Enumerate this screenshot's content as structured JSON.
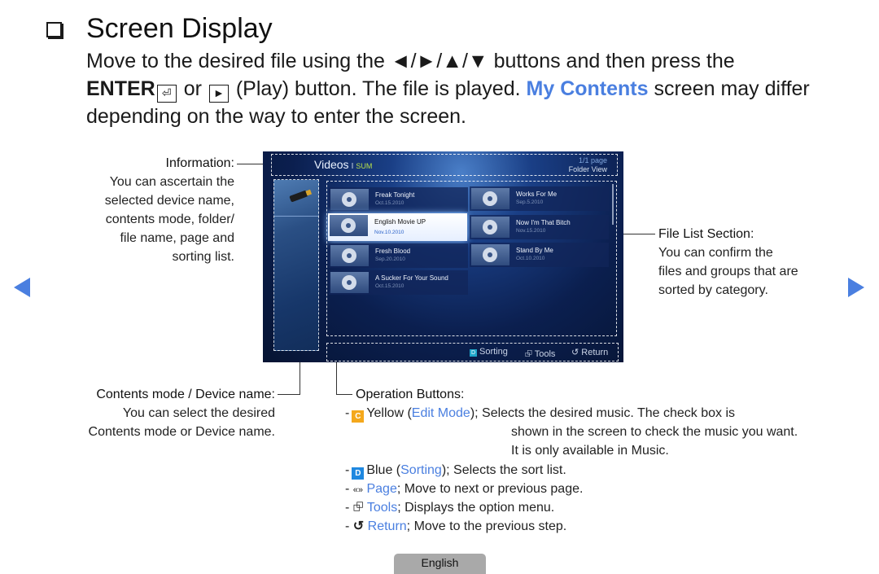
{
  "heading": {
    "checkbox_icon": "square-checkbox-icon",
    "title": "Screen Display"
  },
  "intro": {
    "line1_prefix": "Move to the desired file using the",
    "arrows": "◄/►/▲/▼",
    "line1_suffix": "buttons and then press the",
    "enter_label": "ENTER",
    "enter_icon": "⏎",
    "or": "or",
    "play_icon": "►",
    "line2_mid": "(Play) button. The file is played.",
    "my_contents": "My Contents",
    "line2_suffix": "screen may differ",
    "line3": "depending on the way to enter the screen."
  },
  "nav": {
    "prev_icon": "triangle-left-icon",
    "next_icon": "triangle-right-icon"
  },
  "callouts": {
    "information": {
      "title": "Information",
      "colon": ":",
      "lines": [
        "You can ascertain the",
        "selected device name,",
        "contents mode, folder/",
        "file name, page and",
        "sorting list."
      ]
    },
    "file_list": {
      "title": "File List Section",
      "colon": ":",
      "lines": [
        "You can confirm the",
        "files and groups that are",
        "sorted by category."
      ]
    },
    "contents_mode": {
      "title": "Contents mode / Device name",
      "colon": ":",
      "lines": [
        "You can select the desired",
        "Contents mode or Device name."
      ]
    },
    "operation_buttons": {
      "title": "Operation Buttons",
      "colon": ":"
    }
  },
  "tv": {
    "title": "Videos",
    "separator": "I",
    "mode": "SUM",
    "page": "1/1 page",
    "view": "Folder View",
    "files": [
      {
        "name": "Freak Tonight",
        "date": "Oct.15.2010",
        "selected": false
      },
      {
        "name": "Works For Me",
        "date": "Sep.5.2010",
        "selected": false
      },
      {
        "name": "English Movie UP",
        "date": "Nov.10.2010",
        "selected": true
      },
      {
        "name": "Now I'm That Bitch",
        "date": "Nov.15.2010",
        "selected": false
      },
      {
        "name": "Fresh Blood",
        "date": "Sep.20.2010",
        "selected": false
      },
      {
        "name": "Stand By Me",
        "date": "Oct.10.2010",
        "selected": false
      },
      {
        "name": "A Sucker For Your Sound",
        "date": "Oct.15.2010",
        "selected": false
      }
    ],
    "ops": {
      "sorting_badge": "D",
      "sorting": "Sorting",
      "tools_icon": "⮺",
      "tools": "Tools",
      "return_icon": "↺",
      "return": "Return"
    }
  },
  "operations": [
    {
      "dash": "-",
      "badge": "C",
      "badge_color": "#f4a81c",
      "color_name": "Yellow (",
      "link": "Edit Mode",
      "desc": "); Selects the desired music. The check box is"
    },
    {
      "dash": "-",
      "badge": "D",
      "badge_color": "#1f88e0",
      "color_name": "Blue (",
      "link": "Sorting",
      "desc": "); Selects the sort list."
    },
    {
      "dash": "-",
      "icon": "«»",
      "link": "Page",
      "desc": "; Move to next or previous page."
    },
    {
      "dash": "-",
      "icon": "⮺",
      "link": "Tools",
      "desc": "; Displays the option menu."
    },
    {
      "dash": "-",
      "icon": "↺",
      "link": "Return",
      "desc": "; Move to the previous step."
    }
  ],
  "edit_mode_continued": [
    "shown in the screen to check the music you want.",
    "It is only available in Music."
  ],
  "footer": {
    "language_tab": "English"
  },
  "colors": {
    "accent_blue": "#4a7fe0",
    "yellow_badge": "#f4a81c",
    "blue_badge": "#1f88e0",
    "tv_mode_green": "#b7e04a"
  }
}
